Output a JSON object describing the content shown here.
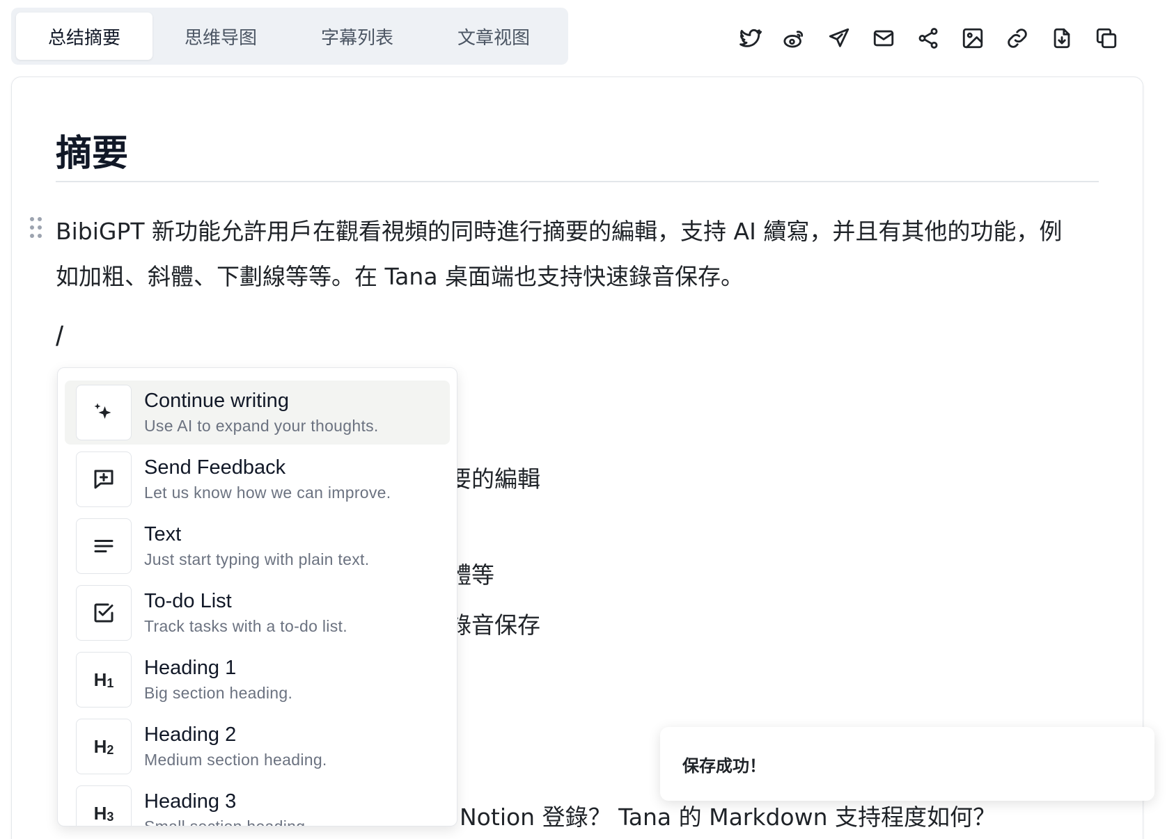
{
  "tabs": [
    {
      "label": "总结摘要",
      "active": true
    },
    {
      "label": "思维导图",
      "active": false
    },
    {
      "label": "字幕列表",
      "active": false
    },
    {
      "label": "文章视图",
      "active": false
    }
  ],
  "toolbar_icons": [
    "twitter-icon",
    "weibo-icon",
    "send-icon",
    "mail-icon",
    "share-icon",
    "image-icon",
    "link-icon",
    "download-icon",
    "copy-icon"
  ],
  "content": {
    "title": "摘要",
    "summary": "BibiGPT 新功能允許用戶在觀看視頻的同時進行摘要的編輯，支持 AI 續寫，并且有其他的功能，例如加粗、斜體、下劃線等等。在 Tana 桌面端也支持快速錄音保存。",
    "slash": "/",
    "hidden_fragments": [
      "要的編輯",
      "體等",
      "錄音保存",
      "Notion 登錄？ Tana 的 Markdown 支持程度如何？"
    ]
  },
  "slash_menu": {
    "items": [
      {
        "title": "Continue writing",
        "desc": "Use AI to expand your thoughts.",
        "icon": "sparkles-icon"
      },
      {
        "title": "Send Feedback",
        "desc": "Let us know how we can improve.",
        "icon": "feedback-icon"
      },
      {
        "title": "Text",
        "desc": "Just start typing with plain text.",
        "icon": "text-icon"
      },
      {
        "title": "To-do List",
        "desc": "Track tasks with a to-do list.",
        "icon": "checkbox-icon"
      },
      {
        "title": "Heading 1",
        "desc": "Big section heading.",
        "icon": "heading-1-icon",
        "glyph": "H",
        "sub": "1"
      },
      {
        "title": "Heading 2",
        "desc": "Medium section heading.",
        "icon": "heading-2-icon",
        "glyph": "H",
        "sub": "2"
      },
      {
        "title": "Heading 3",
        "desc": "Small section heading.",
        "icon": "heading-3-icon",
        "glyph": "H",
        "sub": "3"
      }
    ]
  },
  "toast": {
    "message": "保存成功！"
  }
}
